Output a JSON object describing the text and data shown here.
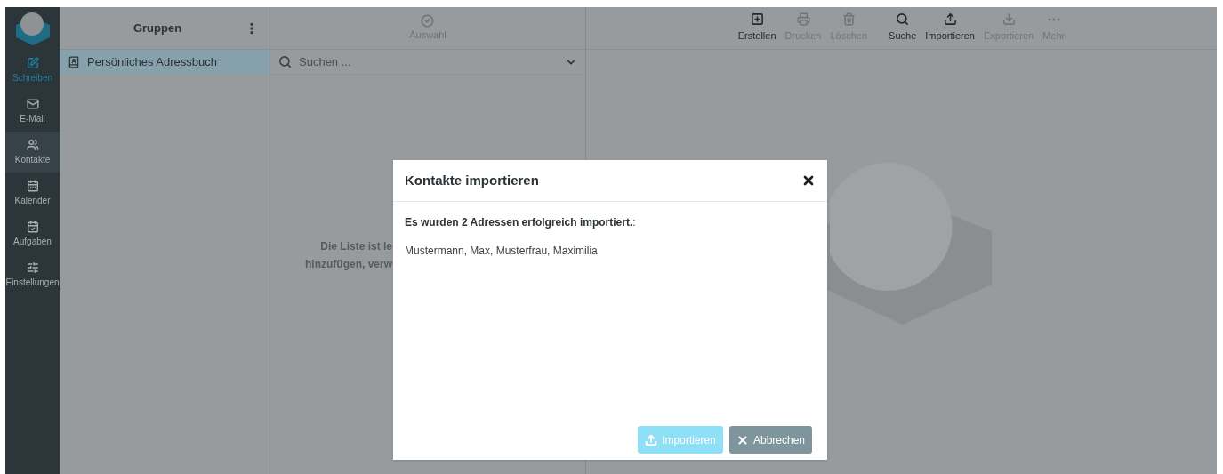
{
  "sidebar": {
    "items": [
      {
        "label": "Schreiben",
        "kind": "compose",
        "selected": false
      },
      {
        "label": "E-Mail",
        "kind": "nav",
        "selected": false
      },
      {
        "label": "Kontakte",
        "kind": "nav",
        "selected": true
      },
      {
        "label": "Kalender",
        "kind": "nav",
        "selected": false
      },
      {
        "label": "Aufgaben",
        "kind": "nav",
        "selected": false
      },
      {
        "label": "Einstellungen",
        "kind": "nav",
        "selected": false
      }
    ]
  },
  "groups": {
    "title": "Gruppen",
    "items": [
      {
        "label": "Persönliches Adressbuch",
        "selected": true
      }
    ]
  },
  "list": {
    "select_label": "Auswahl",
    "search": {
      "placeholder": "Suchen ..."
    },
    "empty_lines": [
      "Die Liste ist le",
      "hinzufügen, verw"
    ]
  },
  "toolbar": [
    {
      "label": "Erstellen",
      "disabled": false
    },
    {
      "label": "Drucken",
      "disabled": true
    },
    {
      "label": "Löschen",
      "disabled": true
    },
    {
      "label": "Suche",
      "disabled": false
    },
    {
      "label": "Importieren",
      "disabled": false
    },
    {
      "label": "Exportieren",
      "disabled": true
    },
    {
      "label": "Mehr",
      "disabled": true
    }
  ],
  "dialog": {
    "title": "Kontakte importieren",
    "message": "**Es wurden 2 Adressen erfolgreich importiert.**:",
    "names": "Mustermann, Max, Musterfrau, Maximilia",
    "buttons": [
      {
        "label": "Importieren",
        "kind": "primary",
        "disabled": true
      },
      {
        "label": "Abbrechen",
        "kind": "cancel",
        "disabled": false
      }
    ]
  }
}
